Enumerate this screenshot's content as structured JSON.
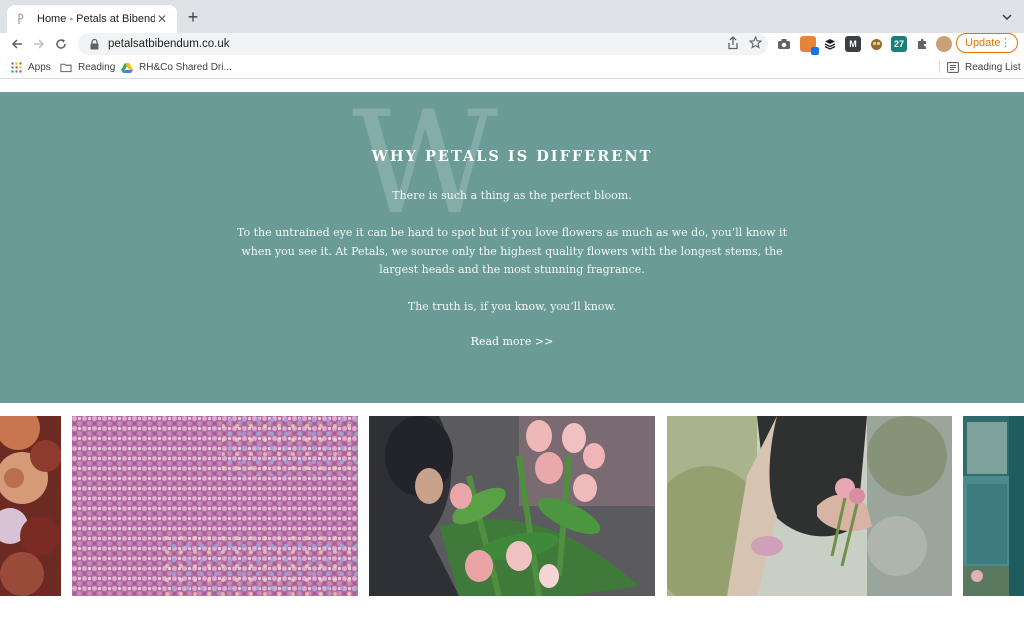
{
  "browser": {
    "tab_title": "Home - Petals at Bibendum",
    "new_tab": "+",
    "url": "petalsatbibendum.co.uk",
    "update_label": "Update",
    "bookmarks": {
      "apps": "Apps",
      "reading": "Reading",
      "shared_drive": "RH&Co Shared Dri...",
      "reading_list": "Reading List"
    }
  },
  "hero": {
    "big_letter": "W",
    "title": "WHY PETALS IS DIFFERENT",
    "paragraph_1": "There is such a thing as the perfect bloom.",
    "paragraph_2": "To the untrained eye it can be hard to spot but if you love flowers as much as we do, you’ll know it when you see it. At Petals, we source only the highest quality flowers with the longest stems, the largest heads and the most stunning fragrance.",
    "paragraph_3": "The truth is, if you know, you’ll know.",
    "read_more": "Read more >>",
    "background_color": "#6a9b96"
  },
  "gallery": {
    "photos": [
      {
        "subject": "roses-arrangement"
      },
      {
        "subject": "pink-gypsophila"
      },
      {
        "subject": "florist-with-pink-tulips"
      },
      {
        "subject": "florist-arranging-flowers"
      },
      {
        "subject": "teal-shopfront"
      }
    ]
  }
}
